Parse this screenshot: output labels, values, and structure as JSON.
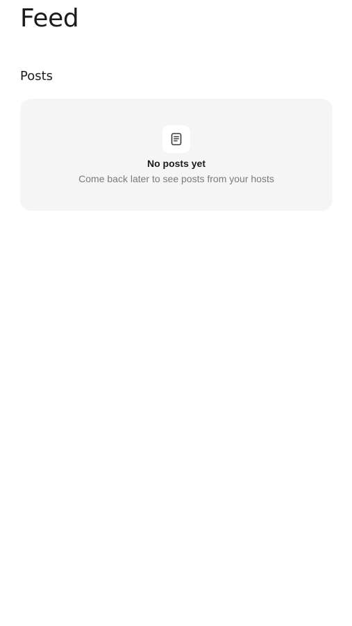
{
  "header": {
    "title": "Feed"
  },
  "posts_section": {
    "title": "Posts",
    "empty_state": {
      "icon": "document-icon",
      "title": "No posts yet",
      "subtitle": "Come back later to see posts from your hosts"
    }
  },
  "colors": {
    "card_background": "#f5f5f5",
    "text_primary": "#1c1b1a",
    "text_secondary": "#7a7a7a"
  }
}
